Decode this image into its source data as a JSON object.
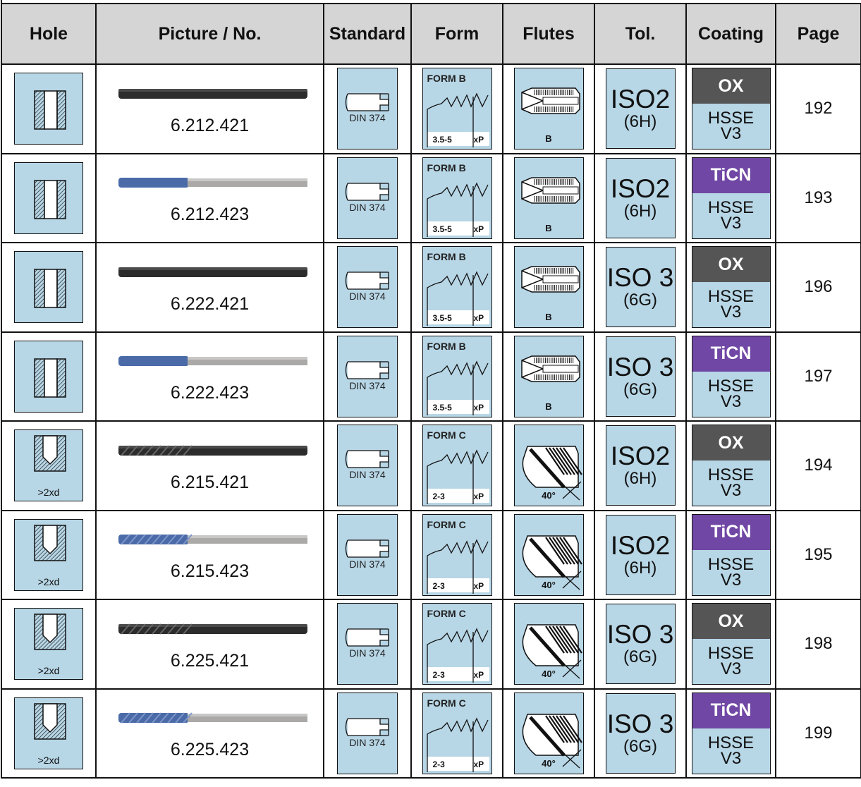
{
  "headers": [
    "Hole",
    "Picture / No.",
    "Standard",
    "Form",
    "Flutes",
    "Tol.",
    "Coating",
    "Page"
  ],
  "colors": {
    "header_bg": "#d5d5d5",
    "icon_bg": "#b7d6e6",
    "ox": "#555555",
    "ticn": "#7047a4"
  },
  "rows": [
    {
      "hole": {
        "type": "through",
        "label": ""
      },
      "picture": {
        "style": "black-straight"
      },
      "no": "6.212.421",
      "standard": "DIN 374",
      "form": {
        "title": "FORM B",
        "dim": "3.5-5",
        "xp": "xP"
      },
      "flutes": {
        "type": "straight",
        "label": "B"
      },
      "tol": {
        "main": "ISO2",
        "sub": "(6H)"
      },
      "coating": {
        "top": "OX",
        "line1": "HSSE",
        "line2": "V3"
      },
      "page": "192"
    },
    {
      "hole": {
        "type": "through",
        "label": ""
      },
      "picture": {
        "style": "blue-straight"
      },
      "no": "6.212.423",
      "standard": "DIN 374",
      "form": {
        "title": "FORM B",
        "dim": "3.5-5",
        "xp": "xP"
      },
      "flutes": {
        "type": "straight",
        "label": "B"
      },
      "tol": {
        "main": "ISO2",
        "sub": "(6H)"
      },
      "coating": {
        "top": "TiCN",
        "line1": "HSSE",
        "line2": "V3"
      },
      "page": "193"
    },
    {
      "hole": {
        "type": "through",
        "label": ""
      },
      "picture": {
        "style": "black-straight"
      },
      "no": "6.222.421",
      "standard": "DIN 374",
      "form": {
        "title": "FORM B",
        "dim": "3.5-5",
        "xp": "xP"
      },
      "flutes": {
        "type": "straight",
        "label": "B"
      },
      "tol": {
        "main": "ISO 3",
        "sub": "(6G)"
      },
      "coating": {
        "top": "OX",
        "line1": "HSSE",
        "line2": "V3"
      },
      "page": "196"
    },
    {
      "hole": {
        "type": "through",
        "label": ""
      },
      "picture": {
        "style": "blue-straight"
      },
      "no": "6.222.423",
      "standard": "DIN 374",
      "form": {
        "title": "FORM B",
        "dim": "3.5-5",
        "xp": "xP"
      },
      "flutes": {
        "type": "straight",
        "label": "B"
      },
      "tol": {
        "main": "ISO 3",
        "sub": "(6G)"
      },
      "coating": {
        "top": "TiCN",
        "line1": "HSSE",
        "line2": "V3"
      },
      "page": "197"
    },
    {
      "hole": {
        "type": "blind",
        "label": ">2xd"
      },
      "picture": {
        "style": "black-spiral"
      },
      "no": "6.215.421",
      "standard": "DIN 374",
      "form": {
        "title": "FORM C",
        "dim": "2-3",
        "xp": "xP"
      },
      "flutes": {
        "type": "spiral",
        "label": "40°"
      },
      "tol": {
        "main": "ISO2",
        "sub": "(6H)"
      },
      "coating": {
        "top": "OX",
        "line1": "HSSE",
        "line2": "V3"
      },
      "page": "194"
    },
    {
      "hole": {
        "type": "blind",
        "label": ">2xd"
      },
      "picture": {
        "style": "blue-spiral"
      },
      "no": "6.215.423",
      "standard": "DIN 374",
      "form": {
        "title": "FORM C",
        "dim": "2-3",
        "xp": "xP"
      },
      "flutes": {
        "type": "spiral",
        "label": "40°"
      },
      "tol": {
        "main": "ISO2",
        "sub": "(6H)"
      },
      "coating": {
        "top": "TiCN",
        "line1": "HSSE",
        "line2": "V3"
      },
      "page": "195"
    },
    {
      "hole": {
        "type": "blind",
        "label": ">2xd"
      },
      "picture": {
        "style": "black-spiral"
      },
      "no": "6.225.421",
      "standard": "DIN 374",
      "form": {
        "title": "FORM C",
        "dim": "2-3",
        "xp": "xP"
      },
      "flutes": {
        "type": "spiral",
        "label": "40°"
      },
      "tol": {
        "main": "ISO 3",
        "sub": "(6G)"
      },
      "coating": {
        "top": "OX",
        "line1": "HSSE",
        "line2": "V3"
      },
      "page": "198"
    },
    {
      "hole": {
        "type": "blind",
        "label": ">2xd"
      },
      "picture": {
        "style": "blue-spiral"
      },
      "no": "6.225.423",
      "standard": "DIN 374",
      "form": {
        "title": "FORM C",
        "dim": "2-3",
        "xp": "xP"
      },
      "flutes": {
        "type": "spiral",
        "label": "40°"
      },
      "tol": {
        "main": "ISO 3",
        "sub": "(6G)"
      },
      "coating": {
        "top": "TiCN",
        "line1": "HSSE",
        "line2": "V3"
      },
      "page": "199"
    }
  ]
}
